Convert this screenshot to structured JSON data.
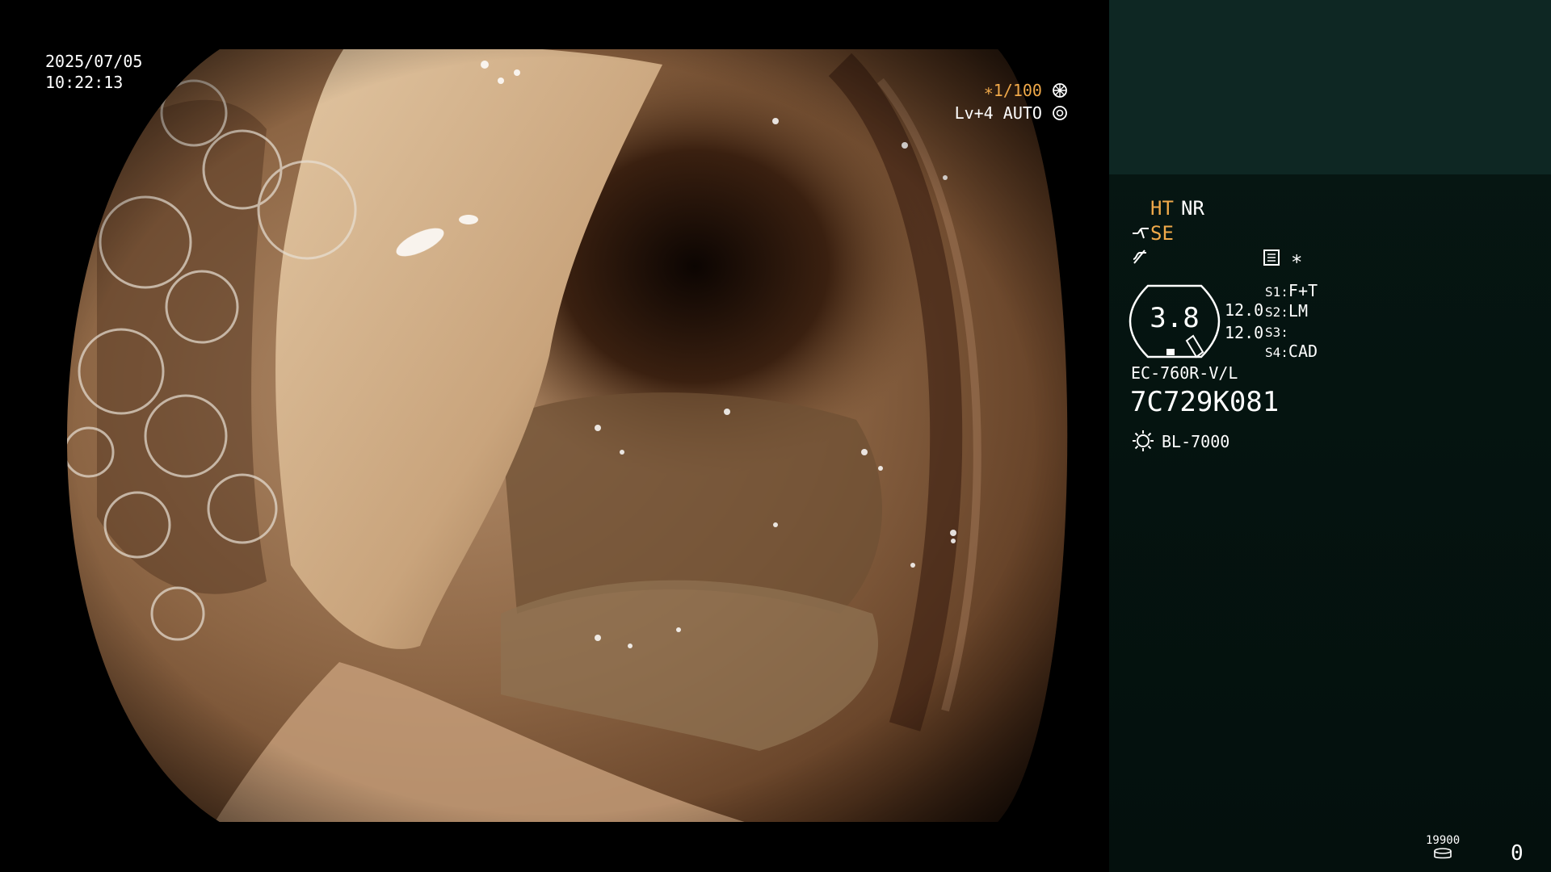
{
  "viewport": {
    "date": "2025/07/05",
    "time": "10:22:13",
    "shutter": "∗1/100",
    "shutter_icon": "aperture-icon",
    "level": "Lv+4",
    "iris_mode": "AUTO",
    "iris_icon": "iris-icon"
  },
  "panel": {
    "ht_label": "HT",
    "nr_label": "NR",
    "se_label": "SE",
    "se_icon": "enhance-curve-icon",
    "slash_icon": "filter-off-icon",
    "memo_icon": "memo-icon",
    "asterisk": "∗",
    "gauge_value": "3.8",
    "value_top": "12.0",
    "value_bottom": "12.0",
    "switches": [
      {
        "key": "S1:",
        "value": "F+T"
      },
      {
        "key": "S2:",
        "value": "LM"
      },
      {
        "key": "S3:",
        "value": ""
      },
      {
        "key": "S4:",
        "value": "CAD"
      }
    ],
    "scope_model": "EC-760R-V/L",
    "serial": "7C729K081",
    "light_icon": "light-source-icon",
    "light_source": "BL-7000",
    "counter_label": "19900",
    "counter_icon": "storage-icon",
    "counter_value": "0"
  },
  "colors": {
    "accent": "#f0a94a",
    "panel_bg": "#061713",
    "panel_top": "#0e2723",
    "text": "#ffffff"
  }
}
